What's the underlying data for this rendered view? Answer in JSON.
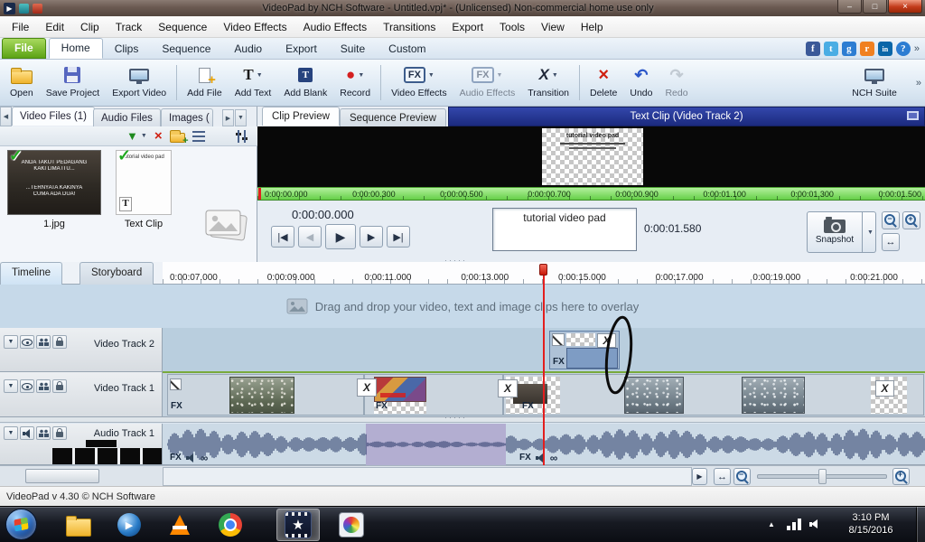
{
  "window": {
    "title": "VideoPad by NCH Software - Untitled.vpj* - (Unlicensed) Non-commercial home use only"
  },
  "icons": {
    "minimize": "–",
    "maximize": "□",
    "close": "×",
    "dropdown": "▼",
    "check": "✓",
    "undo": "↶",
    "redo": "↷",
    "record": "●",
    "delete": "×",
    "go_start": "|◀",
    "step_back": "◀",
    "play": "▶",
    "step_fwd": "▶",
    "go_end": "▶|",
    "left": "◀",
    "right": "▶",
    "up": "▲",
    "fx": "FX",
    "transition_x": "X",
    "text_t": "T",
    "infinity": "∞",
    "star": "★",
    "fit": "↔",
    "chevron_more": "»",
    "help": "?",
    "facebook": "f",
    "twitter": "t",
    "google": "g",
    "rss": "r",
    "linkedin": "in",
    "splitter_dots": "·····"
  },
  "menubar": {
    "items": [
      "File",
      "Edit",
      "Clip",
      "Track",
      "Sequence",
      "Video Effects",
      "Audio Effects",
      "Transitions",
      "Export",
      "Tools",
      "View",
      "Help"
    ]
  },
  "ribbon": {
    "tabs": [
      "File",
      "Home",
      "Clips",
      "Sequence",
      "Audio",
      "Export",
      "Suite",
      "Custom"
    ]
  },
  "toolbar": {
    "labels": [
      "Open",
      "Save Project",
      "Export Video",
      "Add File",
      "Add Text",
      "Add Blank",
      "Record",
      "Video Effects",
      "Audio Effects",
      "Transition",
      "Delete",
      "Undo",
      "Redo",
      "NCH Suite"
    ]
  },
  "media_panel": {
    "tabs": [
      "Video Files (1)",
      "Audio Files",
      "Images ("
    ],
    "items": [
      {
        "label": "1.jpg",
        "caption_lines": [
          "ANDA TAKUT PEDAGANG",
          "KAKI LIMA ITU...",
          "...TERNYATA KAKINYA",
          "CUMA ADA DUA!"
        ]
      },
      {
        "label": "Text Clip",
        "caption": "tutorial video pad"
      }
    ]
  },
  "preview": {
    "tabs": [
      "Clip Preview",
      "Sequence Preview"
    ],
    "header_title": "Text Clip (Video Track 2)",
    "ruler_labels": [
      "0:00:00.000",
      "0:00:00.300",
      "0:00:00.500",
      "0:00:00.700",
      "0:00:00.900",
      "0:00:01.100",
      "0:00:01.300",
      "0:00:01.500"
    ],
    "current_time": "0:00:00.000",
    "overlay_text": "tutorial video pad",
    "clip_duration": "0:00:01.580",
    "snapshot_label": "Snapshot"
  },
  "timeline": {
    "tabs": [
      "Timeline",
      "Storyboard"
    ],
    "ruler_labels": [
      "0:00:07.000",
      "0:00:09.000",
      "0:00:11.000",
      "0:00:13.000",
      "0:00:15.000",
      "0:00:17.000",
      "0:00:19.000",
      "0:00:21.000"
    ],
    "drop_message": "Drag and drop your video, text and image clips here to overlay",
    "tracks": [
      {
        "label": "Video Track 2"
      },
      {
        "label": "Video Track 1"
      },
      {
        "label": "Audio Track 1"
      }
    ]
  },
  "statusbar": {
    "text": "VideoPad v 4.30 © NCH Software"
  },
  "taskbar": {
    "time": "3:10 PM",
    "date": "8/15/2016"
  }
}
